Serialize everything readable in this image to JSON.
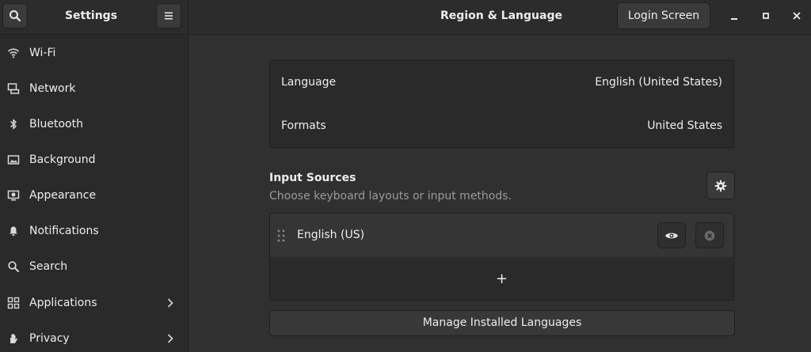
{
  "header": {
    "sidebar_title": "Settings",
    "title": "Region & Language",
    "login_screen_label": "Login Screen"
  },
  "sidebar": {
    "items": [
      {
        "label": "Wi-Fi",
        "icon": "wifi-icon"
      },
      {
        "label": "Network",
        "icon": "network-icon"
      },
      {
        "label": "Bluetooth",
        "icon": "bluetooth-icon"
      },
      {
        "label": "Background",
        "icon": "background-icon"
      },
      {
        "label": "Appearance",
        "icon": "appearance-icon"
      },
      {
        "label": "Notifications",
        "icon": "bell-icon"
      },
      {
        "label": "Search",
        "icon": "search-icon"
      },
      {
        "label": "Applications",
        "icon": "applications-icon"
      },
      {
        "label": "Privacy",
        "icon": "privacy-icon"
      }
    ]
  },
  "locale": {
    "language_label": "Language",
    "language_value": "English (United States)",
    "formats_label": "Formats",
    "formats_value": "United States"
  },
  "input_sources": {
    "title": "Input Sources",
    "subtitle": "Choose keyboard layouts or input methods.",
    "items": [
      {
        "label": "English (US)"
      }
    ],
    "add_symbol": "+"
  },
  "manage_label": "Manage Installed Languages",
  "colors": {
    "background": "#303030",
    "sidebar": "#2a2a2a",
    "text": "#ededed",
    "muted": "#9a9a9a"
  }
}
